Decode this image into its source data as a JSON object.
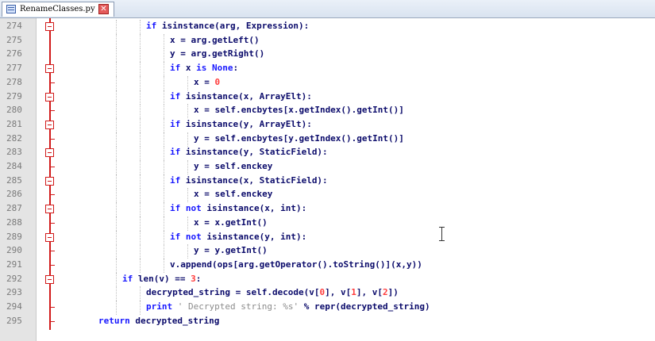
{
  "tab": {
    "label": "RenameClasses.py",
    "icon": "python-file-icon",
    "close_icon": "close-icon"
  },
  "colors": {
    "keyword": "#1717ff",
    "text": "#0b0b6b",
    "number": "#ff3c3c",
    "string": "#8c8c8c",
    "fold": "#d11a1a",
    "line_number": "#7a7a7a"
  },
  "lines": [
    {
      "n": "274",
      "fold": "box",
      "indent": 4,
      "tokens": [
        [
          "kw",
          "if"
        ],
        [
          "t",
          " isinstance(arg, Expression):"
        ]
      ]
    },
    {
      "n": "275",
      "fold": "none",
      "indent": 5,
      "tokens": [
        [
          "t",
          "x = arg.getLeft()"
        ]
      ]
    },
    {
      "n": "276",
      "fold": "none",
      "indent": 5,
      "tokens": [
        [
          "t",
          "y = arg.getRight()"
        ]
      ]
    },
    {
      "n": "277",
      "fold": "box",
      "indent": 5,
      "tokens": [
        [
          "kw",
          "if"
        ],
        [
          "t",
          " x "
        ],
        [
          "kw",
          "is None"
        ],
        [
          "t",
          ":"
        ]
      ]
    },
    {
      "n": "278",
      "fold": "tick",
      "indent": 6,
      "tokens": [
        [
          "t",
          "x = "
        ],
        [
          "num",
          "0"
        ]
      ]
    },
    {
      "n": "279",
      "fold": "box",
      "indent": 5,
      "tokens": [
        [
          "kw",
          "if"
        ],
        [
          "t",
          " isinstance(x, ArrayElt):"
        ]
      ]
    },
    {
      "n": "280",
      "fold": "tick",
      "indent": 6,
      "tokens": [
        [
          "t",
          "x = self.encbytes[x.getIndex().getInt()]"
        ]
      ]
    },
    {
      "n": "281",
      "fold": "box",
      "indent": 5,
      "tokens": [
        [
          "kw",
          "if"
        ],
        [
          "t",
          " isinstance(y, ArrayElt):"
        ]
      ]
    },
    {
      "n": "282",
      "fold": "tick",
      "indent": 6,
      "tokens": [
        [
          "t",
          "y = self.encbytes[y.getIndex().getInt()]"
        ]
      ]
    },
    {
      "n": "283",
      "fold": "box",
      "indent": 5,
      "tokens": [
        [
          "kw",
          "if"
        ],
        [
          "t",
          " isinstance(y, StaticField):"
        ]
      ]
    },
    {
      "n": "284",
      "fold": "tick",
      "indent": 6,
      "tokens": [
        [
          "t",
          "y = self.enckey"
        ]
      ]
    },
    {
      "n": "285",
      "fold": "box",
      "indent": 5,
      "tokens": [
        [
          "kw",
          "if"
        ],
        [
          "t",
          " isinstance(x, StaticField):"
        ]
      ]
    },
    {
      "n": "286",
      "fold": "tick",
      "indent": 6,
      "tokens": [
        [
          "t",
          "x = self.enckey"
        ]
      ]
    },
    {
      "n": "287",
      "fold": "box",
      "indent": 5,
      "tokens": [
        [
          "kw",
          "if not"
        ],
        [
          "t",
          " isinstance(x, int):"
        ]
      ]
    },
    {
      "n": "288",
      "fold": "tick",
      "indent": 6,
      "tokens": [
        [
          "t",
          "x = x.getInt()"
        ]
      ]
    },
    {
      "n": "289",
      "fold": "box",
      "indent": 5,
      "tokens": [
        [
          "kw",
          "if not"
        ],
        [
          "t",
          " isinstance(y, int):"
        ]
      ]
    },
    {
      "n": "290",
      "fold": "tick",
      "indent": 6,
      "tokens": [
        [
          "t",
          "y = y.getInt()"
        ]
      ]
    },
    {
      "n": "291",
      "fold": "tick",
      "indent": 5,
      "tokens": [
        [
          "t",
          "v.append(ops[arg.getOperator().toString()](x,y))"
        ]
      ]
    },
    {
      "n": "292",
      "fold": "box",
      "indent": 3,
      "tokens": [
        [
          "kw",
          "if"
        ],
        [
          "t",
          " len(v) == "
        ],
        [
          "num",
          "3"
        ],
        [
          "t",
          ":"
        ]
      ]
    },
    {
      "n": "293",
      "fold": "none",
      "indent": 4,
      "tokens": [
        [
          "t",
          "decrypted_string = self.decode(v["
        ],
        [
          "num",
          "0"
        ],
        [
          "t",
          "], v["
        ],
        [
          "num",
          "1"
        ],
        [
          "t",
          "], v["
        ],
        [
          "num",
          "2"
        ],
        [
          "t",
          "])"
        ]
      ]
    },
    {
      "n": "294",
      "fold": "tick",
      "indent": 4,
      "tokens": [
        [
          "kw",
          "print"
        ],
        [
          "t",
          " "
        ],
        [
          "str",
          "' Decrypted string: %s'"
        ],
        [
          "t",
          " % repr(decrypted_string)"
        ]
      ]
    },
    {
      "n": "295",
      "fold": "tick",
      "indent": 2,
      "tokens": [
        [
          "kw",
          "return"
        ],
        [
          "t",
          " decrypted_string"
        ]
      ]
    }
  ]
}
